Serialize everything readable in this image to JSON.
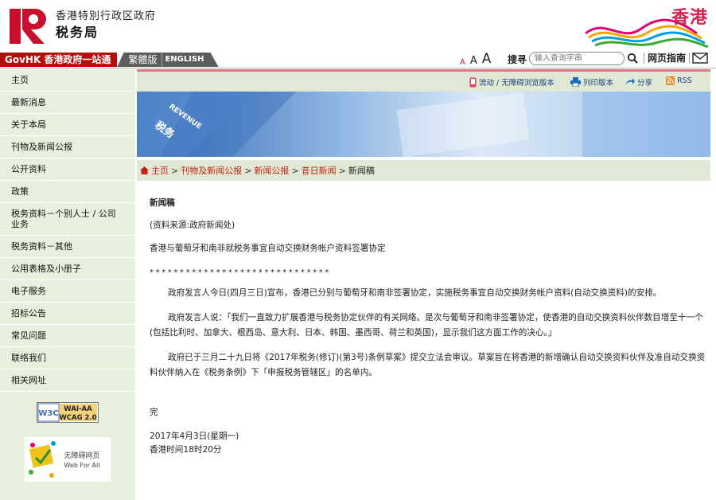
{
  "header": {
    "dept_line1": "香港特別行政区政府",
    "dept_line2": "税务局",
    "brand": "香港"
  },
  "topbar": {
    "govhk": "GovHK 香港政府一站通",
    "traditional": "繁體版",
    "english": "ENGLISH",
    "font_small": "A",
    "font_medium": "A",
    "font_large": "A",
    "search_label": "搜寻",
    "search_placeholder": "输入查询字串",
    "sitemap": "网页指南"
  },
  "sidebar": {
    "items": [
      {
        "label": "主页"
      },
      {
        "label": "最新消息"
      },
      {
        "label": "关于本局"
      },
      {
        "label": "刊物及新闻公报"
      },
      {
        "label": "公开资料"
      },
      {
        "label": "政策"
      },
      {
        "label": "税务资料－个别人士 / 公司业务"
      },
      {
        "label": "税务资料－其他"
      },
      {
        "label": "公用表格及小册子"
      },
      {
        "label": "电子服务"
      },
      {
        "label": "招标公告"
      },
      {
        "label": "常见问题"
      },
      {
        "label": "联络我们"
      },
      {
        "label": "相关网址"
      }
    ],
    "badge_wai_top": "WAI-AA",
    "badge_wai_bottom": "WCAG 2.0",
    "badge_w3c": "W3C",
    "badge_webforall_cn": "无障碍网页",
    "badge_webforall_en": "Web For All"
  },
  "toolstrip": {
    "mobile": "流动 / 无障碍浏览版本",
    "print": "列印版本",
    "share": "分享",
    "rss": "RSS"
  },
  "banner": {
    "text_en": "REVENUE",
    "text_cn": "税务"
  },
  "breadcrumb": {
    "home": "主页",
    "pubs": "刊物及新闻公报",
    "press": "新闻公报",
    "archive": "昔日新闻",
    "current": "新闻稿",
    "sep": ">"
  },
  "article": {
    "title": "新闻稿",
    "source": "(资料来源:政府新闻处)",
    "headline": "香港与葡萄牙和南非就税务事宜自动交换财务帐户资料签署协定",
    "stars": "******************************",
    "p1": "政府发言人今日(四月三日)宣布，香港已分别与葡萄牙和南非签署协定，实施税务事宜自动交换财务帐户资料(自动交换资料)的安排。",
    "p2": "政府发言人说：「我们一直致力扩展香港与税务协定伙伴的有关网络。是次与葡萄牙和南非签署协定，使香港的自动交换资料伙伴数目增至十一个(包括比利时、加拿大、根西岛、意大利、日本、韩国、墨西哥、荷兰和英国)，显示我们这方面工作的决心。」",
    "p3": "政府已于三月二十九日将《2017年税务(修订)(第3号)条例草案》提交立法会审议。草案旨在将香港的新增确认自动交换资料伙伴及准自动交换资料伙伴纳入在《税务条例》下「申报税务管辖区」的名单内。",
    "end": "完",
    "date": "2017年4月3日(星期一)",
    "time": "香港时间18时20分"
  },
  "colors": {
    "logo_red": "#c8102e",
    "sidebar_bg": "#e8f1dd",
    "toolstrip_bg": "#dfe9d5",
    "link_red": "#c42314",
    "tool_blue": "#1d3e78"
  }
}
